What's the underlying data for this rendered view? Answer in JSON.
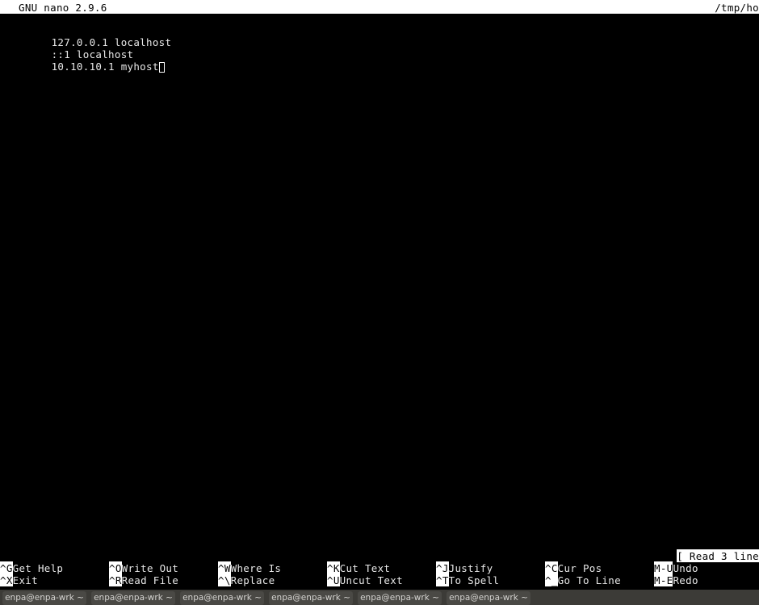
{
  "window": {
    "titlebar": {
      "version_label": "GNU nano 2.9.6",
      "filename_label": "/tmp/ho",
      "bg_color": "#ffffff",
      "fg_color": "#000000"
    }
  },
  "editor": {
    "fg_color": "#e8e8e8",
    "bg_color": "#000000",
    "lines": [
      {
        "text": "127.0.0.1 localhost",
        "has_cursor": false
      },
      {
        "text": "::1 localhost",
        "has_cursor": false
      },
      {
        "text": "10.10.10.1 myhost",
        "has_cursor": true
      }
    ]
  },
  "status": {
    "message": "[ Read 3 line",
    "bg_color": "#ffffff",
    "fg_color": "#000000"
  },
  "shortcuts": {
    "columns": [
      {
        "top": {
          "key": "^G",
          "label": "Get Help"
        },
        "bottom": {
          "key": "^X",
          "label": "Exit"
        }
      },
      {
        "top": {
          "key": "^O",
          "label": "Write Out"
        },
        "bottom": {
          "key": "^R",
          "label": "Read File"
        }
      },
      {
        "top": {
          "key": "^W",
          "label": "Where Is"
        },
        "bottom": {
          "key": "^\\",
          "label": "Replace"
        }
      },
      {
        "top": {
          "key": "^K",
          "label": "Cut Text"
        },
        "bottom": {
          "key": "^U",
          "label": "Uncut Text"
        }
      },
      {
        "top": {
          "key": "^J",
          "label": "Justify"
        },
        "bottom": {
          "key": "^T",
          "label": "To Spell"
        }
      },
      {
        "top": {
          "key": "^C",
          "label": "Cur Pos"
        },
        "bottom": {
          "key": "^_",
          "label": "Go To Line"
        }
      },
      {
        "top": {
          "key": "M-U",
          "label": "Undo"
        },
        "bottom": {
          "key": "M-E",
          "label": "Redo"
        }
      }
    ]
  },
  "taskbar": {
    "bg_color": "#3c3b37",
    "button_color": "#4a4945",
    "items": [
      {
        "label": "enpa@enpa-wrk ~"
      },
      {
        "label": "enpa@enpa-wrk ~"
      },
      {
        "label": "enpa@enpa-wrk ~"
      },
      {
        "label": "enpa@enpa-wrk ~"
      },
      {
        "label": "enpa@enpa-wrk ~"
      },
      {
        "label": "enpa@enpa-wrk ~"
      }
    ]
  }
}
